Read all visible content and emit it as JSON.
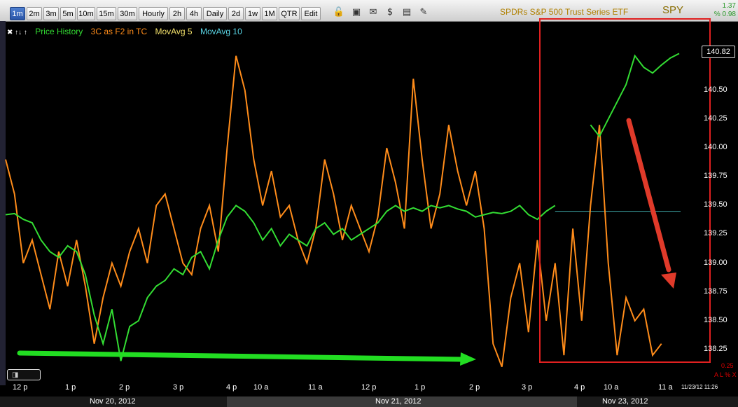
{
  "toolbar": {
    "intervals": [
      "1m",
      "2m",
      "3m",
      "5m",
      "10m",
      "15m",
      "30m",
      "Hourly",
      "2h",
      "4h",
      "Daily",
      "2d",
      "1w",
      "1M",
      "QTR",
      "Edit"
    ],
    "active": "1m",
    "symbol_title": "SPDRs S&P 500 Trust Series ETF",
    "symbol": "SPY",
    "change_abs": "1.37",
    "change_pct": "% 0.98",
    "icons": [
      "lock-icon",
      "save-icon",
      "email-icon",
      "dollar-icon",
      "table-icon",
      "pencil-icon"
    ]
  },
  "legend": {
    "price": "Price History",
    "indicator": "3C as F2 in TC",
    "ma5": "MovAvg 5",
    "ma10": "MovAvg 10",
    "colors": {
      "price": "#33dd33",
      "indicator": "#ff8c1a",
      "ma5": "#f2e06a",
      "ma10": "#5ad6e6"
    }
  },
  "price_tag": "140.82",
  "chart_data": {
    "type": "line",
    "yaxis_ticks": [
      "140.50",
      "140.25",
      "140.00",
      "139.75",
      "139.50",
      "139.25",
      "139.00",
      "138.75",
      "138.50",
      "138.25"
    ],
    "y_value_of_ticks": [
      140.5,
      140.25,
      140.0,
      139.75,
      139.5,
      139.25,
      139.0,
      138.75,
      138.5,
      138.25
    ],
    "ylim": [
      138.0,
      140.95
    ],
    "x_ticks": [
      "12 p",
      "1 p",
      "2 p",
      "3 p",
      "4 p",
      "10 a",
      "11 a",
      "12 p",
      "1 p",
      "2 p",
      "3 p",
      "4 p",
      "10 a",
      "11 a"
    ],
    "dates": [
      "Nov 20, 2012",
      "Nov 21, 2012",
      "Nov 23, 2012"
    ],
    "last_price": 140.82,
    "reference_line": 139.45,
    "price_series": [
      [
        0,
        139.42
      ],
      [
        1,
        139.43
      ],
      [
        2,
        139.38
      ],
      [
        3,
        139.35
      ],
      [
        4,
        139.2
      ],
      [
        5,
        139.1
      ],
      [
        6,
        139.05
      ],
      [
        7,
        139.15
      ],
      [
        8,
        139.1
      ],
      [
        9,
        138.9
      ],
      [
        10,
        138.55
      ],
      [
        11,
        138.3
      ],
      [
        12,
        138.6
      ],
      [
        13,
        138.15
      ],
      [
        14,
        138.45
      ],
      [
        15,
        138.5
      ],
      [
        16,
        138.7
      ],
      [
        17,
        138.8
      ],
      [
        18,
        138.85
      ],
      [
        19,
        138.95
      ],
      [
        20,
        138.9
      ],
      [
        21,
        139.05
      ],
      [
        22,
        139.1
      ],
      [
        23,
        138.95
      ],
      [
        24,
        139.2
      ],
      [
        25,
        139.4
      ],
      [
        26,
        139.5
      ],
      [
        27,
        139.45
      ],
      [
        28,
        139.35
      ],
      [
        29,
        139.2
      ],
      [
        30,
        139.3
      ],
      [
        31,
        139.15
      ],
      [
        32,
        139.25
      ],
      [
        33,
        139.2
      ],
      [
        34,
        139.15
      ],
      [
        35,
        139.3
      ],
      [
        36,
        139.35
      ],
      [
        37,
        139.25
      ],
      [
        38,
        139.3
      ],
      [
        39,
        139.2
      ],
      [
        40,
        139.25
      ],
      [
        41,
        139.3
      ],
      [
        42,
        139.35
      ],
      [
        43,
        139.45
      ],
      [
        44,
        139.5
      ],
      [
        45,
        139.45
      ],
      [
        46,
        139.48
      ],
      [
        47,
        139.45
      ],
      [
        48,
        139.5
      ],
      [
        49,
        139.48
      ],
      [
        50,
        139.5
      ],
      [
        51,
        139.47
      ],
      [
        52,
        139.45
      ],
      [
        53,
        139.4
      ],
      [
        54,
        139.42
      ],
      [
        55,
        139.44
      ],
      [
        56,
        139.43
      ],
      [
        57,
        139.45
      ],
      [
        58,
        139.5
      ],
      [
        59,
        139.42
      ],
      [
        60,
        139.38
      ],
      [
        61,
        139.45
      ],
      [
        62,
        139.5
      ]
    ],
    "price_series_nov23": [
      [
        66,
        140.2
      ],
      [
        67,
        140.1
      ],
      [
        68,
        140.25
      ],
      [
        69,
        140.4
      ],
      [
        70,
        140.55
      ],
      [
        71,
        140.8
      ],
      [
        72,
        140.7
      ],
      [
        73,
        140.65
      ],
      [
        74,
        140.72
      ],
      [
        75,
        140.78
      ],
      [
        76,
        140.82
      ]
    ],
    "indicator_series": [
      [
        0,
        139.9
      ],
      [
        1,
        139.6
      ],
      [
        2,
        139.0
      ],
      [
        3,
        139.2
      ],
      [
        4,
        138.9
      ],
      [
        5,
        138.6
      ],
      [
        6,
        139.1
      ],
      [
        7,
        138.8
      ],
      [
        8,
        139.2
      ],
      [
        9,
        138.8
      ],
      [
        10,
        138.3
      ],
      [
        11,
        138.7
      ],
      [
        12,
        139.0
      ],
      [
        13,
        138.8
      ],
      [
        14,
        139.1
      ],
      [
        15,
        139.3
      ],
      [
        16,
        139.0
      ],
      [
        17,
        139.5
      ],
      [
        18,
        139.6
      ],
      [
        19,
        139.3
      ],
      [
        20,
        139.0
      ],
      [
        21,
        138.9
      ],
      [
        22,
        139.3
      ],
      [
        23,
        139.5
      ],
      [
        24,
        139.1
      ],
      [
        25,
        140.0
      ],
      [
        26,
        140.8
      ],
      [
        27,
        140.5
      ],
      [
        28,
        139.9
      ],
      [
        29,
        139.5
      ],
      [
        30,
        139.8
      ],
      [
        31,
        139.4
      ],
      [
        32,
        139.5
      ],
      [
        33,
        139.2
      ],
      [
        34,
        139.0
      ],
      [
        35,
        139.3
      ],
      [
        36,
        139.9
      ],
      [
        37,
        139.6
      ],
      [
        38,
        139.2
      ],
      [
        39,
        139.5
      ],
      [
        40,
        139.3
      ],
      [
        41,
        139.1
      ],
      [
        42,
        139.4
      ],
      [
        43,
        140.0
      ],
      [
        44,
        139.7
      ],
      [
        45,
        139.3
      ],
      [
        46,
        140.6
      ],
      [
        47,
        139.9
      ],
      [
        48,
        139.3
      ],
      [
        49,
        139.6
      ],
      [
        50,
        140.2
      ],
      [
        51,
        139.8
      ],
      [
        52,
        139.5
      ],
      [
        53,
        139.8
      ],
      [
        54,
        139.3
      ],
      [
        55,
        138.3
      ],
      [
        56,
        138.1
      ],
      [
        57,
        138.7
      ],
      [
        58,
        139.0
      ],
      [
        59,
        138.4
      ],
      [
        60,
        139.2
      ],
      [
        61,
        138.5
      ],
      [
        62,
        139.0
      ],
      [
        63,
        138.2
      ],
      [
        64,
        139.3
      ],
      [
        65,
        138.5
      ],
      [
        66,
        139.5
      ],
      [
        67,
        140.2
      ],
      [
        68,
        139.0
      ],
      [
        69,
        138.2
      ],
      [
        70,
        138.7
      ],
      [
        71,
        138.5
      ],
      [
        72,
        138.6
      ],
      [
        73,
        138.2
      ],
      [
        74,
        138.3
      ]
    ],
    "annotations": [
      {
        "kind": "rectangle",
        "color": "#e02020"
      },
      {
        "kind": "arrow",
        "color": "#22dd22",
        "direction": "right"
      },
      {
        "kind": "arrow",
        "color": "#e03a2a",
        "direction": "down-right"
      }
    ],
    "grid": false
  },
  "corner_label": "0.25",
  "corner_ctrls": "A L % X",
  "timestamp": "11/23/12 11:26"
}
